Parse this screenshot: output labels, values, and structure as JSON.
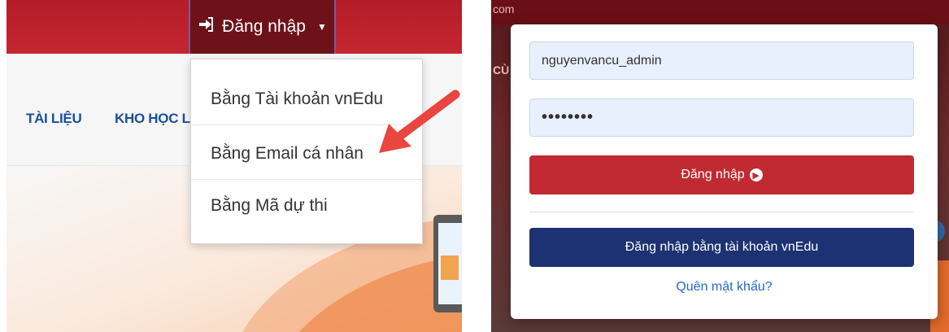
{
  "left": {
    "login_toggle_label": "Đăng nhập",
    "nav": [
      "TÀI LIỆU",
      "KHO HỌC L"
    ],
    "dropdown": {
      "items": [
        "Bằng Tài khoản vnEdu",
        "Bằng Email cá nhân",
        "Bằng Mã dự thi"
      ]
    }
  },
  "right": {
    "url_fragment": "com",
    "bg_text": "CÙ",
    "form": {
      "username_value": "nguyenvancu_admin",
      "password_value": "••••••••",
      "submit_label": "Đăng nhập",
      "vnedu_label": "Đăng nhập bằng tài khoản vnEdu",
      "forgot_label": "Quên mật khẩu?"
    }
  },
  "colors": {
    "brand_red": "#c12a32",
    "dark_red": "#6e1219",
    "navy": "#1c3272",
    "link_blue": "#2469c9",
    "arrow_red": "#e8463e"
  },
  "icons": [
    "sign-in-icon",
    "caret-down-icon",
    "arrow-circle-right-icon",
    "annotation-arrow-icon"
  ]
}
